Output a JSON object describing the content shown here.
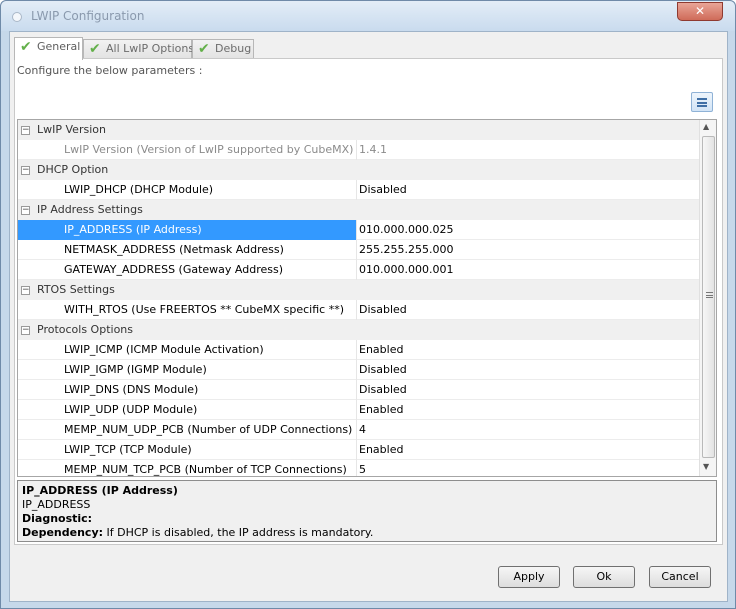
{
  "window": {
    "title": "LWIP Configuration",
    "close_glyph": "✕"
  },
  "tabs": [
    {
      "label": "General",
      "icon": "check-icon",
      "active": true
    },
    {
      "label": "All LwIP Options",
      "icon": "check-icon",
      "active": false
    },
    {
      "label": "Debug",
      "icon": "check-icon",
      "active": false
    }
  ],
  "config_label": "Configure the below parameters :",
  "tree": {
    "collapse_glyph": "−",
    "groups": [
      {
        "label": "LwIP Version",
        "items": [
          {
            "param": "LwIP Version (Version of LwIP supported by CubeMX)",
            "value": "1.4.1",
            "readonly": true
          }
        ]
      },
      {
        "label": "DHCP Option",
        "items": [
          {
            "param": "LWIP_DHCP (DHCP Module)",
            "value": "Disabled"
          }
        ]
      },
      {
        "label": "IP Address Settings",
        "items": [
          {
            "param": "IP_ADDRESS (IP Address)",
            "value": "010.000.000.025",
            "selected": true
          },
          {
            "param": "NETMASK_ADDRESS (Netmask Address)",
            "value": "255.255.255.000"
          },
          {
            "param": "GATEWAY_ADDRESS (Gateway Address)",
            "value": "010.000.000.001"
          }
        ]
      },
      {
        "label": "RTOS Settings",
        "items": [
          {
            "param": "WITH_RTOS (Use FREERTOS ** CubeMX specific **)",
            "value": "Disabled"
          }
        ]
      },
      {
        "label": "Protocols Options",
        "items": [
          {
            "param": "LWIP_ICMP (ICMP Module Activation)",
            "value": "Enabled"
          },
          {
            "param": "LWIP_IGMP (IGMP Module)",
            "value": "Disabled"
          },
          {
            "param": "LWIP_DNS (DNS Module)",
            "value": "Disabled"
          },
          {
            "param": "LWIP_UDP (UDP Module)",
            "value": "Enabled"
          },
          {
            "param": "MEMP_NUM_UDP_PCB (Number of UDP Connections)",
            "value": "4"
          },
          {
            "param": "LWIP_TCP (TCP Module)",
            "value": "Enabled"
          },
          {
            "param": "MEMP_NUM_TCP_PCB (Number of TCP Connections)",
            "value": "5"
          }
        ]
      }
    ]
  },
  "description": {
    "title": "IP_ADDRESS (IP Address)",
    "name": "IP_ADDRESS",
    "diagnostic_label": "Diagnostic:",
    "dependency_label": "Dependency:",
    "dependency_text": " If DHCP is disabled, the IP address is mandatory."
  },
  "buttons": {
    "apply": "Apply",
    "ok": "Ok",
    "cancel": "Cancel"
  },
  "colors": {
    "selection": "#3399ff",
    "check": "#63b04a",
    "close": "#cf6b59"
  }
}
